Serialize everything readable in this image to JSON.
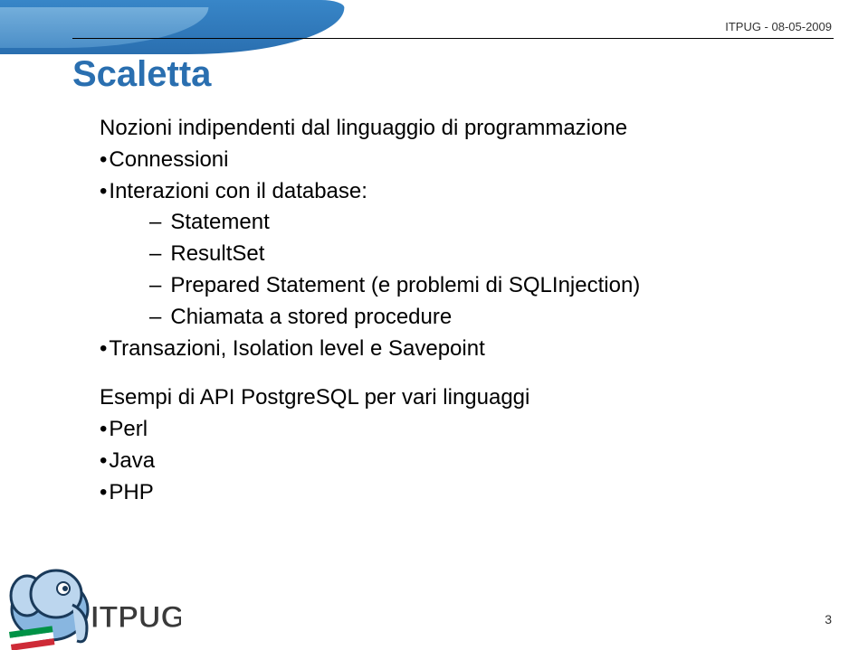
{
  "header_right": "ITPUG - 08-05-2009",
  "title": "Scaletta",
  "content": {
    "line1": "Nozioni indipendenti dal linguaggio di programmazione",
    "bullet_connessioni": "Connessioni",
    "bullet_interazioni": "Interazioni con il database:",
    "sub_statement": "Statement",
    "sub_resultset": "ResultSet",
    "sub_prepared": "Prepared Statement  (e problemi di SQLInjection)",
    "sub_chiamata": "Chiamata a stored procedure",
    "bullet_transazioni": "Transazioni, Isolation level e Savepoint",
    "line_esempi": "Esempi di API  PostgreSQL per vari linguaggi",
    "bullet_perl": "Perl",
    "bullet_java": "Java",
    "bullet_php": "PHP"
  },
  "page_number": "3",
  "logo_text": "ITPUG"
}
